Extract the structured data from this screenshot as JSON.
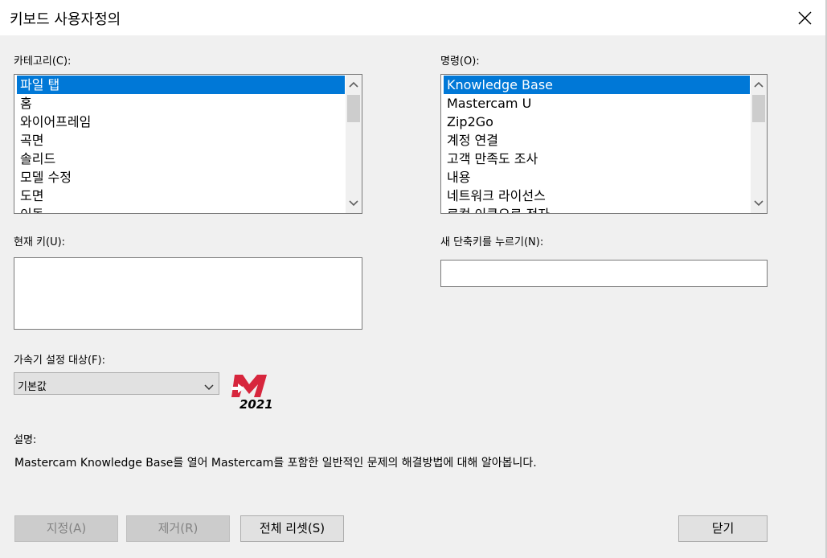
{
  "window": {
    "title": "키보드 사용자정의"
  },
  "category": {
    "label": "카테고리(C):",
    "items": [
      "파일 탭",
      "홈",
      "와이어프레임",
      "곡면",
      "솔리드",
      "모델 수정",
      "도면",
      "이동"
    ],
    "selected_index": 0
  },
  "command": {
    "label": "명령(O):",
    "items": [
      "Knowledge Base",
      "Mastercam U",
      "Zip2Go",
      "계정 연결",
      "고객 만족도 조사",
      "내용",
      "네트워크 라이선스",
      "로컬 이클오로 전자"
    ],
    "selected_index": 0
  },
  "current_key": {
    "label": "현재 키(U):",
    "value": ""
  },
  "new_shortcut": {
    "label": "새 단축키를 누르기(N):",
    "value": ""
  },
  "accelerator": {
    "label": "가속기 설정 대상(F):",
    "selected": "기본값"
  },
  "logo": {
    "year": "2021"
  },
  "description": {
    "label": "설명:",
    "text": "Mastercam Knowledge Base를 열어 Mastercam를 포함한 일반적인 문제의 해결방법에 대해 알아봅니다."
  },
  "buttons": {
    "assign": "지정(A)",
    "remove": "제거(R)",
    "reset_all": "전체 리셋(S)",
    "close": "닫기"
  },
  "colors": {
    "selection": "#0078d7",
    "logo_red": "#d7263d"
  }
}
